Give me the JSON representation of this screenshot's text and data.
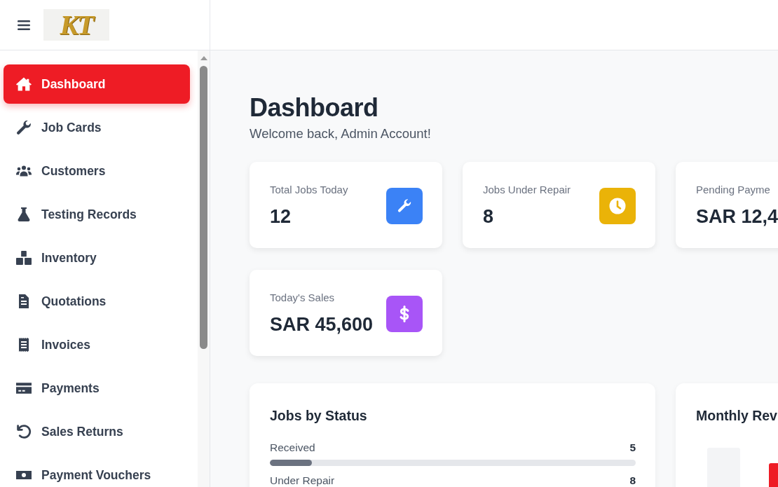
{
  "header": {
    "logo": "KT"
  },
  "sidebar": {
    "items": [
      {
        "label": "Dashboard",
        "selected": true
      },
      {
        "label": "Job Cards",
        "selected": false
      },
      {
        "label": "Customers",
        "selected": false
      },
      {
        "label": "Testing Records",
        "selected": false
      },
      {
        "label": "Inventory",
        "selected": false
      },
      {
        "label": "Quotations",
        "selected": false
      },
      {
        "label": "Invoices",
        "selected": false
      },
      {
        "label": "Payments",
        "selected": false
      },
      {
        "label": "Sales Returns",
        "selected": false
      },
      {
        "label": "Payment Vouchers",
        "selected": false
      }
    ]
  },
  "page": {
    "title": "Dashboard",
    "subtitle": "Welcome back, Admin Account!"
  },
  "stat_rows": [
    [
      {
        "label": "Total Jobs Today",
        "value": "12",
        "color": "#3b82f6"
      },
      {
        "label": "Jobs Under Repair",
        "value": "8",
        "color": "#eab308"
      },
      {
        "label": "Pending Payme",
        "value": "SAR 12,4"
      }
    ],
    [
      {
        "label": "Today's Sales",
        "value": "SAR 45,600",
        "color": "#a855f7"
      }
    ]
  ],
  "panels": [
    {
      "kind": "status",
      "title": "Jobs by Status",
      "rows": [
        {
          "label": "Received",
          "count": "5",
          "level": 0.115,
          "color": "#6b7280"
        },
        {
          "label": "Under Repair",
          "count": "8"
        }
      ]
    },
    {
      "kind": "chart",
      "title": "Monthly Rev"
    }
  ]
}
